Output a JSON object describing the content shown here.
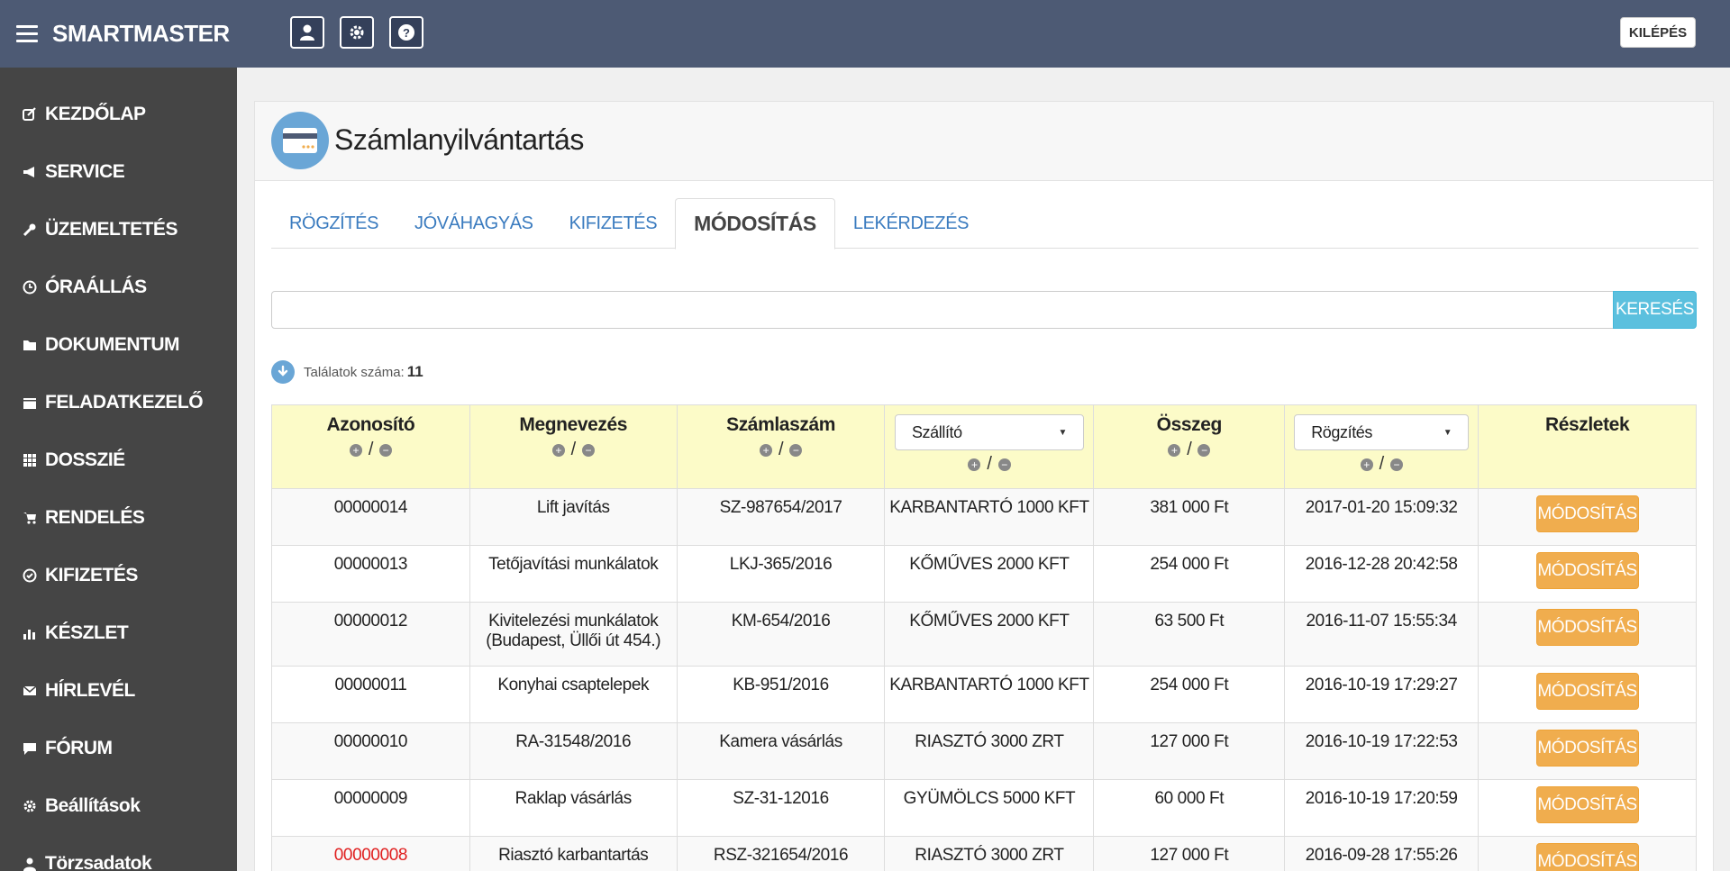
{
  "app": {
    "brand": "SMARTMASTER",
    "logout_label": "KILÉPÉS"
  },
  "topbar": {
    "icons": [
      "user-icon",
      "gear-icon",
      "help-icon"
    ]
  },
  "sidebar": {
    "items": [
      {
        "label": "KEZDŐLAP",
        "icon": "edit-icon"
      },
      {
        "label": "SERVICE",
        "icon": "megaphone-icon"
      },
      {
        "label": "ÜZEMELTETÉS",
        "icon": "wrench-icon"
      },
      {
        "label": "ÓRAÁLLÁS",
        "icon": "clock-icon"
      },
      {
        "label": "DOKUMENTUM",
        "icon": "folder-icon"
      },
      {
        "label": "FELADATKEZELŐ",
        "icon": "calendar-icon"
      },
      {
        "label": "DOSSZIÉ",
        "icon": "grid-icon"
      },
      {
        "label": "RENDELÉS",
        "icon": "cart-icon"
      },
      {
        "label": "KIFIZETÉS",
        "icon": "check-circle-icon"
      },
      {
        "label": "KÉSZLET",
        "icon": "bar-chart-icon"
      },
      {
        "label": "HÍRLEVÉL",
        "icon": "envelope-icon"
      },
      {
        "label": "FÓRUM",
        "icon": "comment-icon"
      },
      {
        "label": "Beállítások",
        "icon": "cog-icon"
      },
      {
        "label": "Törzsadatok",
        "icon": "user-icon"
      }
    ]
  },
  "page": {
    "title": "Számlanyilvántartás",
    "icon": "credit-card-icon"
  },
  "tabs": [
    {
      "label": "RÖGZÍTÉS",
      "active": false
    },
    {
      "label": "JÓVÁHAGYÁS",
      "active": false
    },
    {
      "label": "KIFIZETÉS",
      "active": false
    },
    {
      "label": "MÓDOSÍTÁS",
      "active": true
    },
    {
      "label": "LEKÉRDEZÉS",
      "active": false
    }
  ],
  "search": {
    "value": "",
    "placeholder": "",
    "button_label": "KERESÉS"
  },
  "results": {
    "label": "Találatok száma:",
    "count": "11"
  },
  "table": {
    "columns": {
      "id": "Azonosító",
      "name": "Megnevezés",
      "invoice": "Számlaszám",
      "supplier_select": "Szállító",
      "amount": "Összeg",
      "recorded_select": "Rögzítés",
      "details": "Részletek"
    },
    "sort_separator": "/",
    "action_label": "MÓDOSÍTÁS",
    "rows": [
      {
        "id": "00000014",
        "name": [
          "Lift javítás"
        ],
        "invoice": "SZ-987654/2017",
        "supplier": "KARBANTARTÓ 1000 KFT",
        "amount": "381 000 Ft",
        "recorded": "2017-01-20 15:09:32",
        "id_color": "#222222"
      },
      {
        "id": "00000013",
        "name": [
          "Tetőjavítási munkálatok"
        ],
        "invoice": "LKJ-365/2016",
        "supplier": "KŐMŰVES 2000 KFT",
        "amount": "254 000 Ft",
        "recorded": "2016-12-28 20:42:58",
        "id_color": "#222222"
      },
      {
        "id": "00000012",
        "name": [
          "Kivitelezési munkálatok",
          "(Budapest, Üllői út 454.)"
        ],
        "invoice": "KM-654/2016",
        "supplier": "KŐMŰVES 2000 KFT",
        "amount": "63 500 Ft",
        "recorded": "2016-11-07 15:55:34",
        "id_color": "#222222"
      },
      {
        "id": "00000011",
        "name": [
          "Konyhai csaptelepek"
        ],
        "invoice": "KB-951/2016",
        "supplier": "KARBANTARTÓ 1000 KFT",
        "amount": "254 000 Ft",
        "recorded": "2016-10-19 17:29:27",
        "id_color": "#222222"
      },
      {
        "id": "00000010",
        "name": [
          "RA-31548/2016"
        ],
        "invoice": "Kamera vásárlás",
        "supplier": "RIASZTÓ 3000 ZRT",
        "amount": "127 000 Ft",
        "recorded": "2016-10-19 17:22:53",
        "id_color": "#222222"
      },
      {
        "id": "00000009",
        "name": [
          "Raklap vásárlás"
        ],
        "invoice": "SZ-31-12016",
        "supplier": "GYÜMÖLCS 5000 KFT",
        "amount": "60 000 Ft",
        "recorded": "2016-10-19 17:20:59",
        "id_color": "#222222"
      },
      {
        "id": "00000008",
        "name": [
          "Riasztó karbantartás"
        ],
        "invoice": "RSZ-321654/2016",
        "supplier": "RIASZTÓ 3000 ZRT",
        "amount": "127 000 Ft",
        "recorded": "2016-09-28 17:55:26",
        "id_color": "#e02020"
      }
    ]
  },
  "colors": {
    "topbar": "#4d5a74",
    "sidebar": "#454545",
    "link": "#3a7bbf",
    "header_row": "#fcfbc8",
    "action": "#f0ad4e",
    "search_button": "#5bc0de"
  }
}
